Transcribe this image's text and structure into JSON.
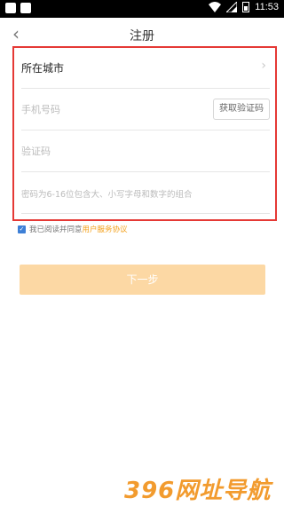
{
  "status": {
    "time": "11:53"
  },
  "header": {
    "back_icon": "chevron-left-icon",
    "title": "注册"
  },
  "form": {
    "city_label": "所在城市",
    "phone_placeholder": "手机号码",
    "get_code_label": "获取验证码",
    "code_placeholder": "验证码",
    "password_placeholder": "密码为6-16位包含大、小写字母和数字的组合"
  },
  "agreement": {
    "checked": true,
    "text": "我已阅读并同意",
    "link": "用户服务协议"
  },
  "next_button": {
    "label": "下一步"
  },
  "watermark": {
    "text": "396网址导航"
  },
  "colors": {
    "accent_orange": "#f3a019",
    "button_disabled": "#fcd8a4",
    "highlight_border": "#e53935",
    "checkbox_blue": "#3d7fd6"
  }
}
